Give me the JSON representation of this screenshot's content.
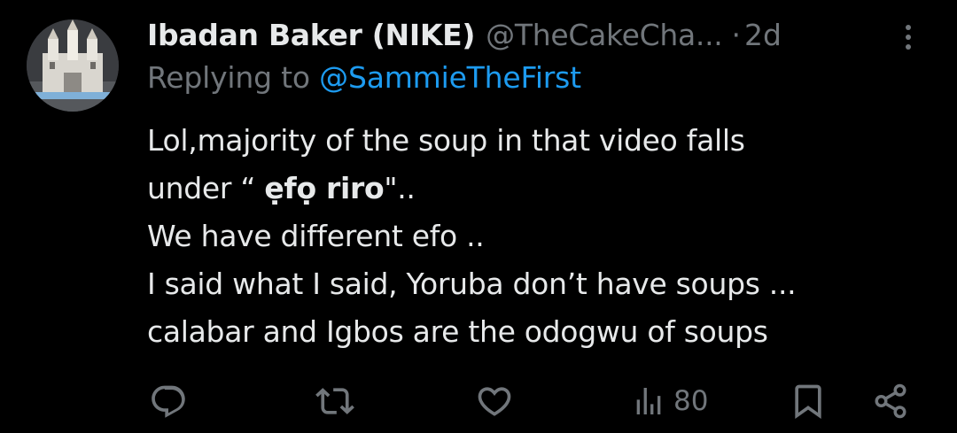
{
  "author": {
    "display_name": "Ibadan Baker (NIKE)",
    "handle": "@TheCakeCha...",
    "separator": "·",
    "time": "2d"
  },
  "reply": {
    "prefix": "Replying to ",
    "target": "@SammieTheFirst"
  },
  "body": {
    "line1": "Lol,majority of the soup in that video falls",
    "line2_pre": "under “ ",
    "line2_bold": "ẹfọ riro",
    "line2_post": "\"..",
    "line3": "We have different efo ..",
    "line4": "I said what I said, Yoruba don’t have soups ...",
    "line5": "calabar and Igbos are the odogwu of soups"
  },
  "actions": {
    "views": "80"
  },
  "icons": {
    "avatar": "cake-castle-avatar",
    "more": "more-vertical-icon",
    "reply": "reply-icon",
    "repost": "repost-icon",
    "like": "heart-icon",
    "views": "views-icon",
    "bookmark": "bookmark-icon",
    "share": "share-icon"
  },
  "colors": {
    "background": "#000000",
    "text": "#e7e9ea",
    "muted": "#71767b",
    "link": "#1d9bf0"
  }
}
